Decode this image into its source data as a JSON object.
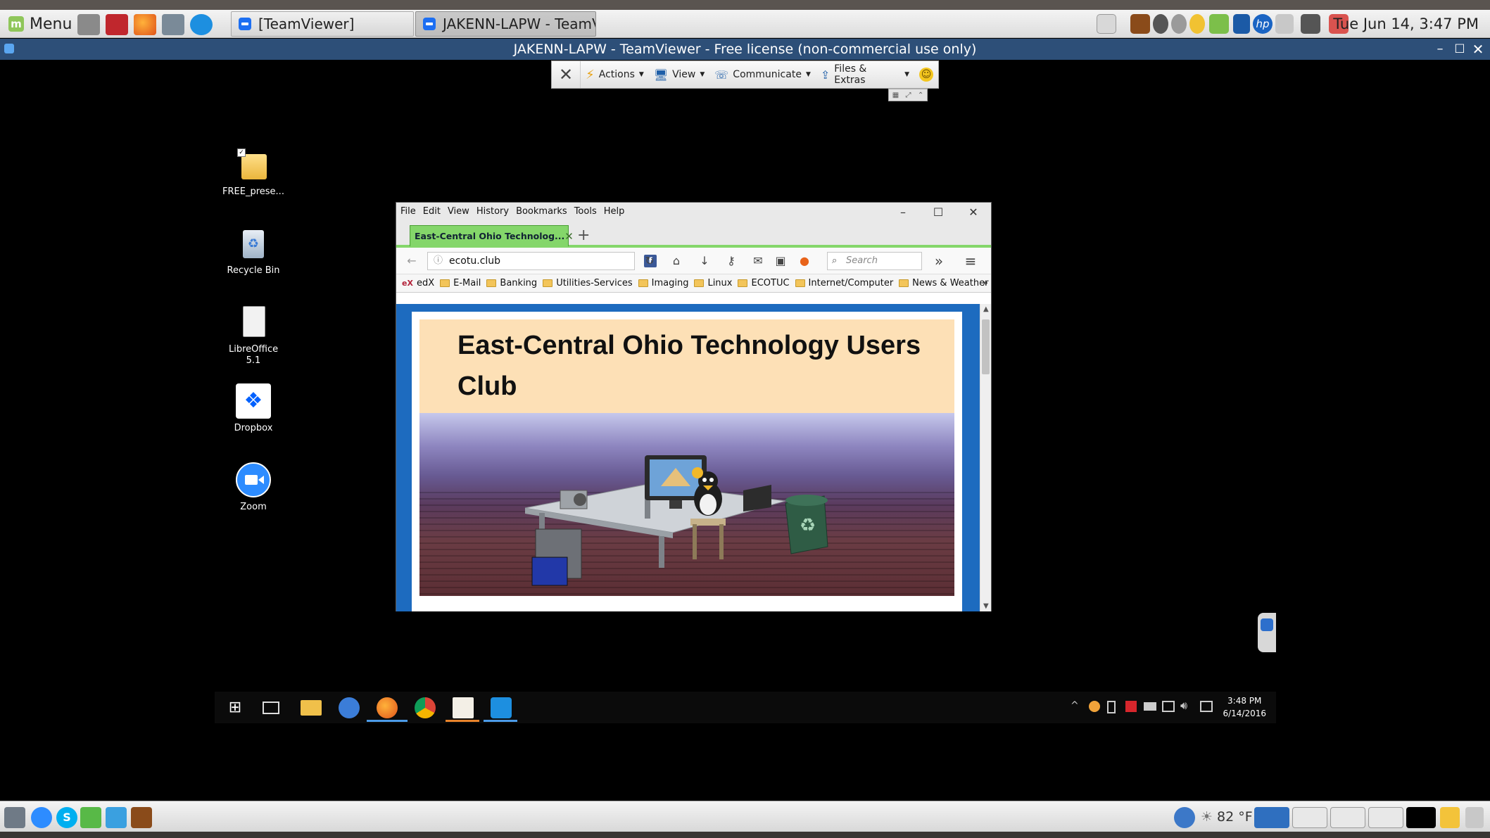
{
  "linux_panel": {
    "menu_label": "Menu",
    "tasks": [
      {
        "label": "[TeamViewer]"
      },
      {
        "label": "JAKENN-LAPW - TeamVi..."
      }
    ],
    "clock": "Tue Jun 14,  3:47 PM"
  },
  "teamviewer": {
    "window_title": "JAKENN-LAPW - TeamViewer - Free license (non-commercial use only)",
    "toolbar": {
      "actions": "Actions",
      "view": "View",
      "communicate": "Communicate",
      "files": "Files & Extras"
    }
  },
  "remote_desktop": {
    "icons": [
      {
        "label": "FREE_prese..."
      },
      {
        "label": "Recycle Bin"
      },
      {
        "label": "LibreOffice 5.1"
      },
      {
        "label": "Dropbox"
      },
      {
        "label": "Zoom"
      }
    ],
    "taskbar_clock": {
      "time": "3:48 PM",
      "date": "6/14/2016"
    }
  },
  "firefox": {
    "menus": [
      "File",
      "Edit",
      "View",
      "History",
      "Bookmarks",
      "Tools",
      "Help"
    ],
    "tab_title": "East-Central Ohio Technolog...",
    "url": "ecotu.club",
    "search_placeholder": "Search",
    "bookmarks": [
      "edX",
      "E-Mail",
      "Banking",
      "Utilities-Services",
      "Imaging",
      "Linux",
      "ECOTUC",
      "Internet/Computer",
      "News & Weather"
    ],
    "page_heading": "East-Central Ohio Technology Users Club"
  },
  "bottom_panel": {
    "weather": "82 °F"
  },
  "colors": {
    "teamviewer_titlebar": "#2d4f78",
    "firefox_tab_green": "#84d66a",
    "page_blue": "#1d6bbf",
    "banner_peach": "#fde0b6"
  }
}
